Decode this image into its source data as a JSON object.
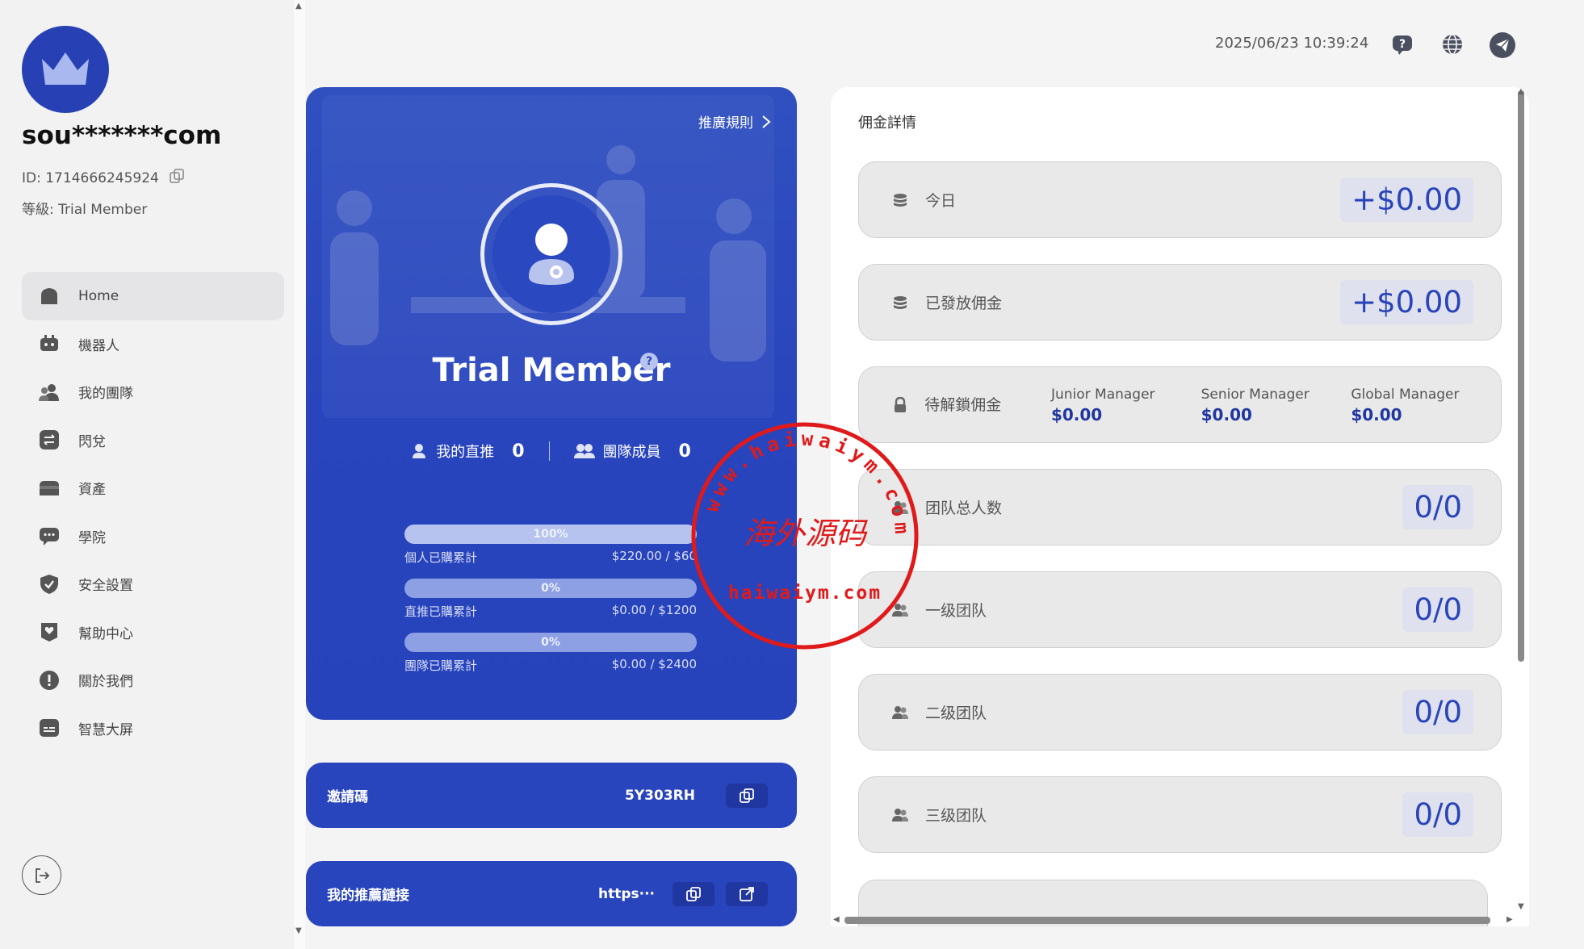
{
  "user": {
    "name": "sou*******com",
    "id_label": "ID: 1714666245924",
    "level_label": "等級: Trial Member"
  },
  "nav": {
    "items": [
      {
        "label": "Home",
        "icon": "home-icon"
      },
      {
        "label": "機器人",
        "icon": "robot-icon"
      },
      {
        "label": "我的團隊",
        "icon": "team-icon"
      },
      {
        "label": "閃兌",
        "icon": "swap-icon"
      },
      {
        "label": "資產",
        "icon": "wallet-icon"
      },
      {
        "label": "學院",
        "icon": "chat-icon"
      },
      {
        "label": "安全設置",
        "icon": "shield-icon"
      },
      {
        "label": "幫助中心",
        "icon": "heart-icon"
      },
      {
        "label": "關於我們",
        "icon": "info-icon"
      },
      {
        "label": "智慧大屏",
        "icon": "screen-icon"
      }
    ]
  },
  "header": {
    "datetime": "2025/06/23 10:39:24"
  },
  "member": {
    "rules_label": "推廣規則",
    "tier": "Trial Member",
    "help": "?",
    "direct_label": "我的直推",
    "direct_count": "0",
    "team_label": "團隊成員",
    "team_count": "0",
    "progress": [
      {
        "pct_label": "100%",
        "pct": 1.0,
        "label": "個人已購累計",
        "value": "$220.00 / $60"
      },
      {
        "pct_label": "0%",
        "pct": 0,
        "label": "直推已購累計",
        "value": "$0.00 / $1200"
      },
      {
        "pct_label": "0%",
        "pct": 0,
        "label": "團隊已購累計",
        "value": "$0.00 / $2400"
      }
    ]
  },
  "invite": {
    "label": "邀請碼",
    "code": "5Y303RH"
  },
  "referral": {
    "label": "我的推薦鏈接",
    "link": "https···"
  },
  "commission": {
    "title": "佣金詳情",
    "today_label": "今日",
    "today_value": "+$0.00",
    "issued_label": "已發放佣金",
    "issued_value": "+$0.00",
    "locked_label": "待解鎖佣金",
    "levels": [
      {
        "name": "Junior Manager",
        "value": "$0.00"
      },
      {
        "name": "Senior Manager",
        "value": "$0.00"
      },
      {
        "name": "Global Manager",
        "value": "$0.00"
      }
    ],
    "team_total_label": "团队总人数",
    "team_total_value": "0/0",
    "lvl1_label": "一级团队",
    "lvl1_value": "0/0",
    "lvl2_label": "二级团队",
    "lvl2_value": "0/0",
    "lvl3_label": "三级团队",
    "lvl3_value": "0/0"
  },
  "watermark": {
    "main": "海外源码",
    "url": "haiwaiym.com",
    "ring_text": "www.haiwaiym.com"
  },
  "colors": {
    "brand": "#2945bd",
    "accent_text": "#2a45b9",
    "watermark": "#e01a1a"
  }
}
